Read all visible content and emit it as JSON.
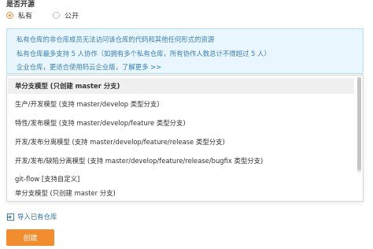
{
  "visibility": {
    "label": "是否开源",
    "options": [
      {
        "label": "私有",
        "checked": true
      },
      {
        "label": "公开",
        "checked": false
      }
    ]
  },
  "notice": {
    "line1": "私有仓库的非仓库成员无法访问该仓库的代码和其他任何形式的资源",
    "line2": "私有仓库最多支持 5 人协作（如拥有多个私有仓库，所有协作人数总计不得超过 5 人）",
    "line3_text": "企业仓库，更适合使用码云企业版，",
    "line3_link": "了解更多 >>"
  },
  "branch_model": {
    "options": [
      "单分支模型 (只创建 master 分支)",
      "生产/开发模型 (支持 master/develop 类型分支)",
      "特性/发布模型 (支持 master/develop/feature 类型分支)",
      "开发/发布分离模型 (支持 master/develop/feature/release 类型分支)",
      "开发/发布/缺陷分离模型 (支持 master/develop/feature/release/bugfix 类型分支)",
      "git-flow [支持自定义]",
      "单分支模型 (只创建 master 分支)"
    ]
  },
  "import_link": "导入已有仓库",
  "create_button": "创建",
  "colors": {
    "accent": "#f18c2f",
    "info_bg": "#eaf6fd",
    "info_text": "#3a7fb0",
    "link": "#2d6fa3"
  }
}
